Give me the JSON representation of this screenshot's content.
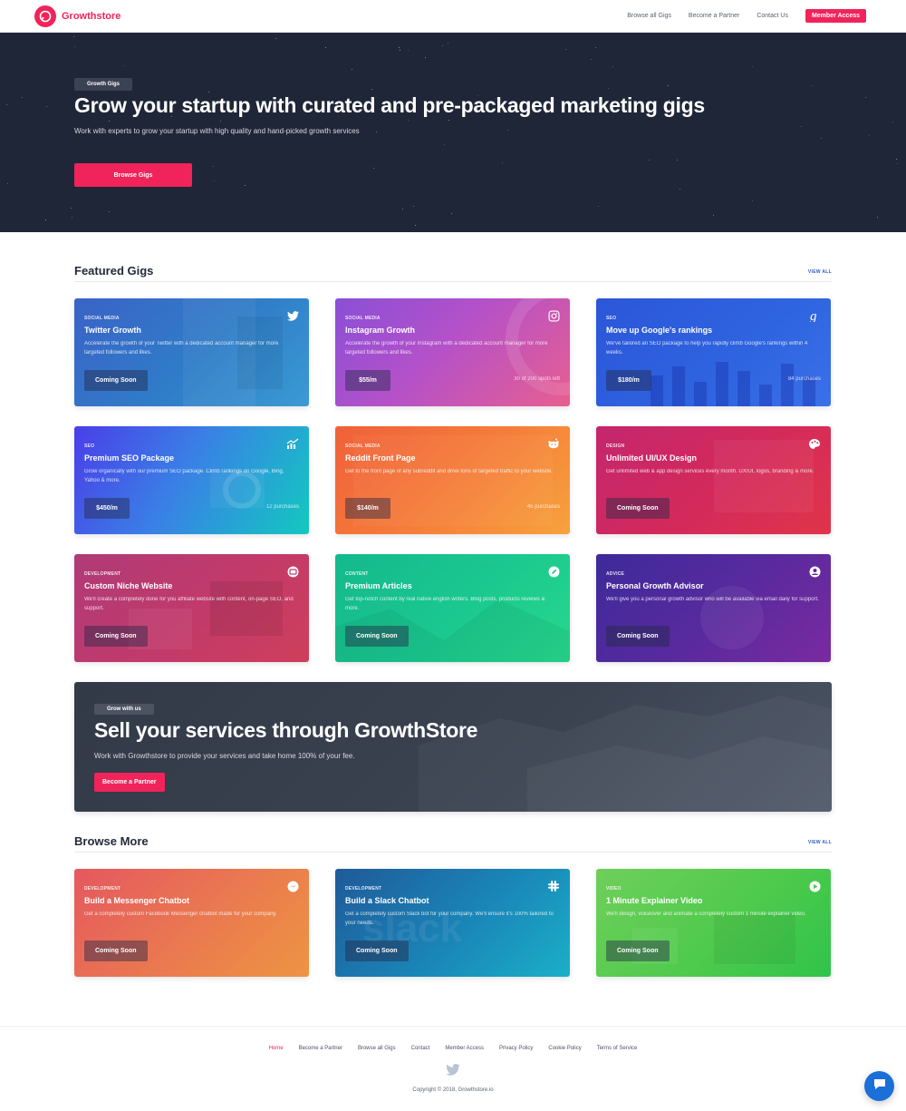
{
  "brand": {
    "name": "Growthstore",
    "accent": "#f0245a"
  },
  "nav": {
    "links": [
      "Browse all Gigs",
      "Become a Partner",
      "Contact Us"
    ],
    "member_label": "Member Access"
  },
  "hero": {
    "badge": "Growth Gigs",
    "title": "Grow your startup with curated and pre-packaged marketing gigs",
    "subtitle": "Work with experts to grow your startup with high quality and hand-picked growth services",
    "cta": "Browse Gigs"
  },
  "featured": {
    "title": "Featured Gigs",
    "view_all": "VIEW ALL",
    "cards": [
      {
        "category": "SOCIAL MEDIA",
        "title": "Twitter Growth",
        "desc": "Accelerate the growth of your Twitter with a dedicated account manager for more targeted followers and likes.",
        "button": "Coming Soon",
        "meta": "",
        "icon": "twitter-icon"
      },
      {
        "category": "SOCIAL MEDIA",
        "title": "Instagram Growth",
        "desc": "Accelerate the growth of your Instagram with a dedicated account manager for more targeted followers and likes.",
        "button": "$55/m",
        "meta": "30 of 200 spots left",
        "icon": "instagram-icon"
      },
      {
        "category": "SEO",
        "title": "Move up Google's rankings",
        "desc": "We've tailored an SEO package to help you rapidly climb Google's rankings within 4 weeks.",
        "button": "$180/m",
        "meta": "84 purchases",
        "icon": "google-icon"
      },
      {
        "category": "SEO",
        "title": "Premium SEO Package",
        "desc": "Grow organically with our premium SEO package. Climb rankings on Google, Bing, Yahoo & more.",
        "button": "$450/m",
        "meta": "12 purchases",
        "icon": "chart-up-icon"
      },
      {
        "category": "SOCIAL MEDIA",
        "title": "Reddit Front Page",
        "desc": "Get to the front page of any subreddit and drive tons of targeted traffic to your website.",
        "button": "$140/m",
        "meta": "45 purchases",
        "icon": "reddit-icon"
      },
      {
        "category": "DESIGN",
        "title": "Unlimited UI/UX Design",
        "desc": "Get unlimited web & app design services every month. UX/UI, logos, branding & more.",
        "button": "Coming Soon",
        "meta": "",
        "icon": "palette-icon"
      },
      {
        "category": "DEVELOPMENT",
        "title": "Custom Niche Website",
        "desc": "We'll create a completely done for you affiliate website with content, on-page SEO, and support.",
        "button": "Coming Soon",
        "meta": "",
        "icon": "browser-icon"
      },
      {
        "category": "CONTENT",
        "title": "Premium Articles",
        "desc": "Get top-notch content by real native english writers. Blog posts, products reviews & more.",
        "button": "Coming Soon",
        "meta": "",
        "icon": "pencil-icon"
      },
      {
        "category": "ADVICE",
        "title": "Personal Growth Advisor",
        "desc": "We'll give you a personal growth advisor who will be available via email daily for support.",
        "button": "Coming Soon",
        "meta": "",
        "icon": "user-icon"
      }
    ]
  },
  "partner": {
    "badge": "Grow with us",
    "title": "Sell your services through GrowthStore",
    "subtitle": "Work with Growthstore to provide your services and take home 100% of your fee.",
    "cta": "Become a Partner"
  },
  "browse_more": {
    "title": "Browse More",
    "view_all": "VIEW ALL",
    "cards": [
      {
        "category": "DEVELOPMENT",
        "title": "Build a Messenger Chatbot",
        "desc": "Get a completely custom Facebook Messenger chatbot made for your company.",
        "button": "Coming Soon",
        "icon": "messenger-icon"
      },
      {
        "category": "DEVELOPMENT",
        "title": "Build a Slack Chatbot",
        "desc": "Get a completely custom Slack bot for your company. We'll ensure it's 100% tailored to your needs.",
        "button": "Coming Soon",
        "icon": "slack-icon"
      },
      {
        "category": "VIDEO",
        "title": "1 Minute Explainer Video",
        "desc": "We'll design, voiceover and animate a completely custom 1 minute explainer video.",
        "button": "Coming Soon",
        "icon": "play-icon"
      }
    ]
  },
  "footer": {
    "links": [
      "Home",
      "Become a Partner",
      "Browse all Gigs",
      "Contact",
      "Member Access",
      "Privacy Policy",
      "Cookie Policy",
      "Terms of Service"
    ],
    "copyright": "Copyright © 2018, Growthstore.io"
  }
}
